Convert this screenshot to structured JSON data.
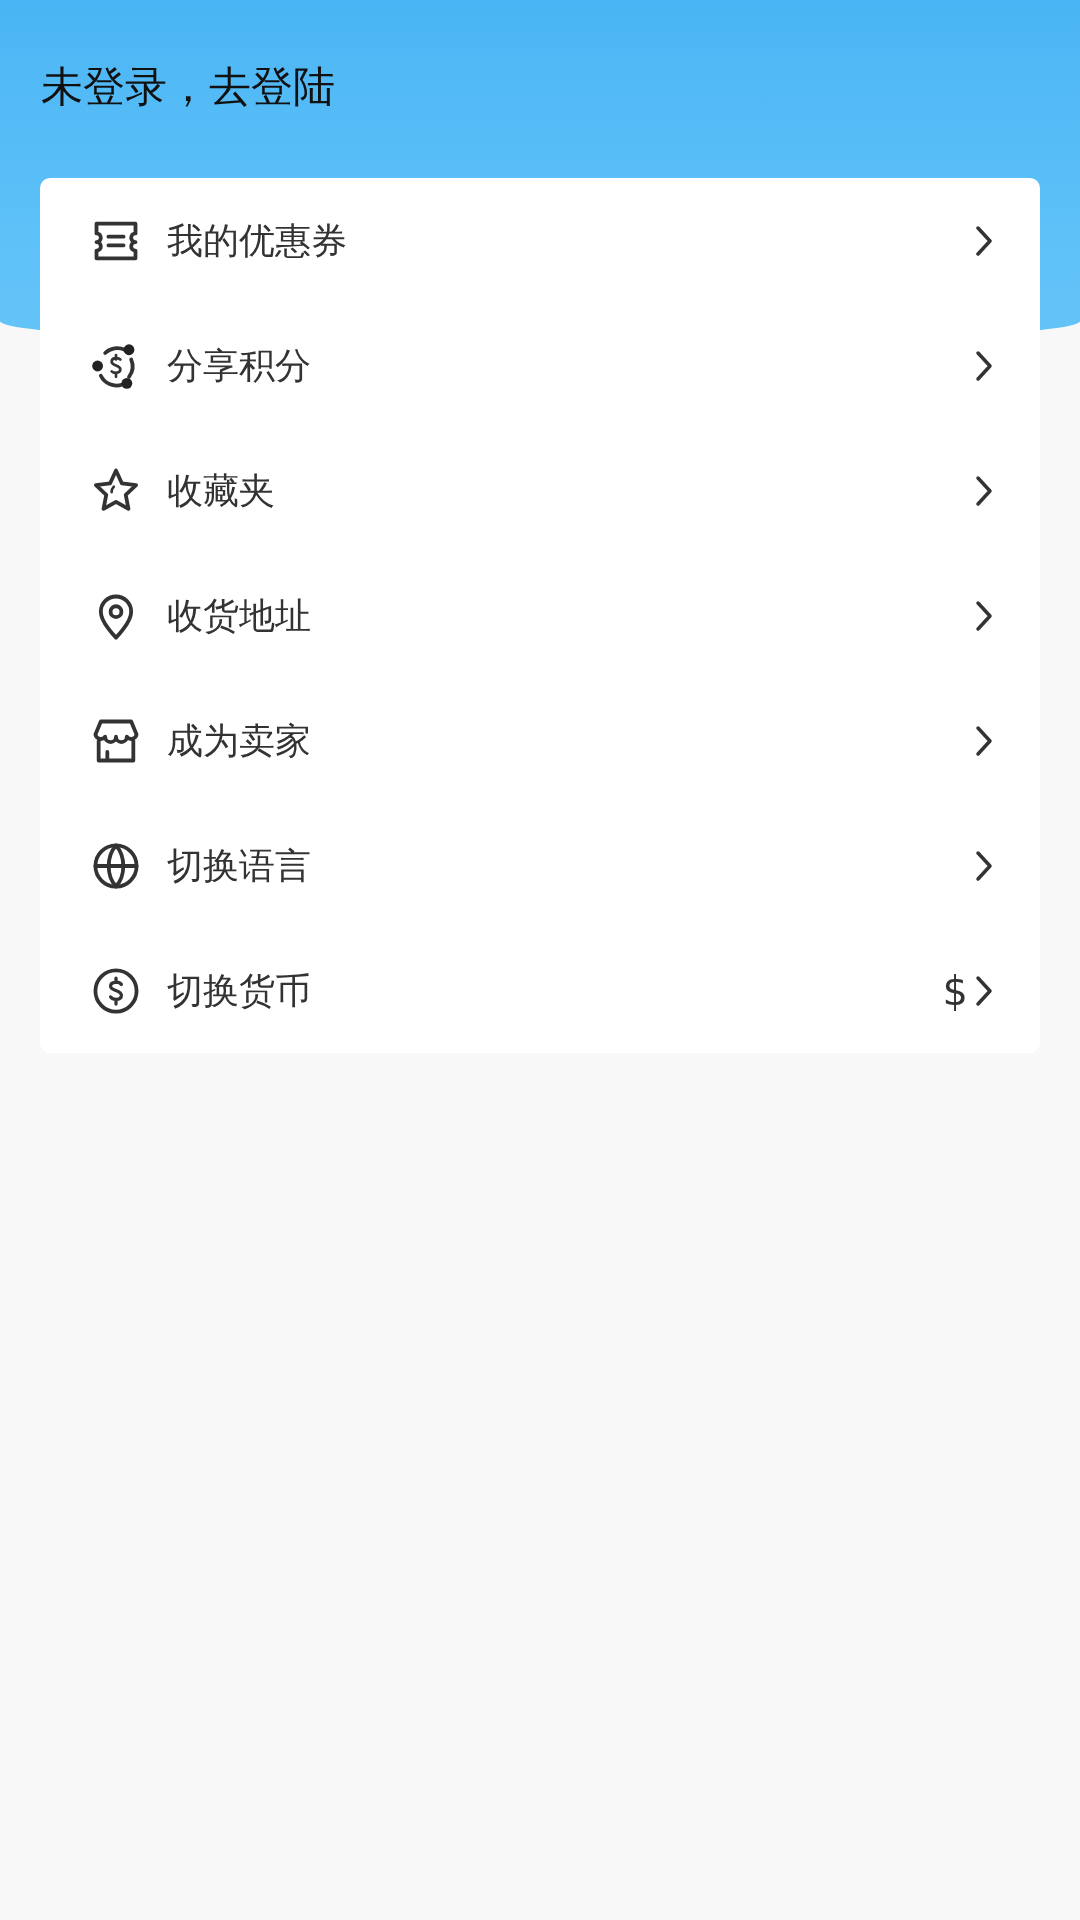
{
  "header": {
    "login_prompt": "未登录，去登陆"
  },
  "menu": [
    {
      "kind": "coupon",
      "label": "我的优惠券"
    },
    {
      "kind": "share",
      "label": "分享积分"
    },
    {
      "kind": "star",
      "label": "收藏夹"
    },
    {
      "kind": "location",
      "label": "收货地址"
    },
    {
      "kind": "store",
      "label": "成为卖家"
    },
    {
      "kind": "globe",
      "label": "切换语言"
    },
    {
      "kind": "currency",
      "label": "切换货币",
      "value": "$"
    }
  ]
}
